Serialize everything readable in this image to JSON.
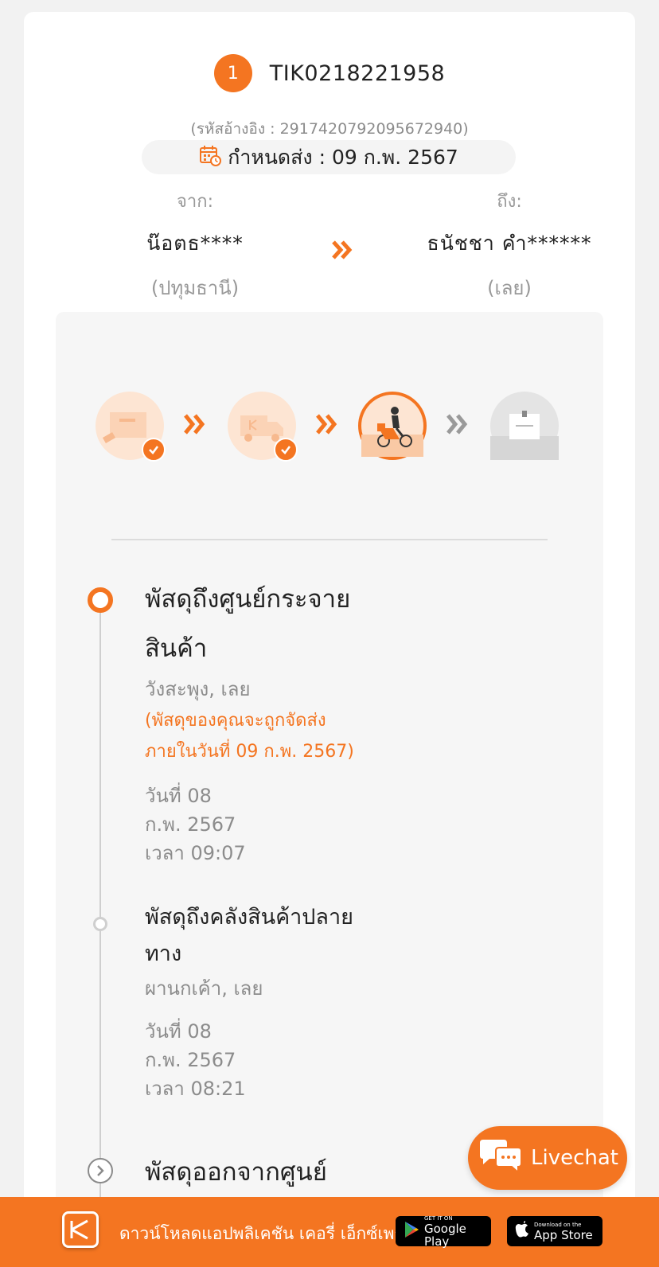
{
  "header": {
    "index": "1",
    "tracking_number": "TIK0218221958",
    "reference": "(รหัสอ้างอิง : 2917420792095672940)",
    "due_date": "กำหนดส่ง : 09 ก.พ. 2567"
  },
  "sender": {
    "label": "จาก:",
    "name": "น๊อตธ****",
    "province": "(ปทุมธานี)"
  },
  "receiver": {
    "label": "ถึง:",
    "name": "ธนัชชา คำ******",
    "province": "(เลย)"
  },
  "steps": [
    {
      "icon": "parcel-picked-icon",
      "done": true
    },
    {
      "icon": "truck-icon",
      "done": true
    },
    {
      "icon": "delivery-rider-icon",
      "current": true
    },
    {
      "icon": "delivered-box-icon",
      "done": false
    }
  ],
  "timeline": [
    {
      "title_line1": "พัสดุถึงศูนย์กระจาย",
      "title_line2": "สินค้า",
      "location": "วังสะพุง, เลย",
      "note_line1": "(พัสดุของคุณจะถูกจัดส่ง",
      "note_line2": "ภายในวันที่ 09 ก.พ. 2567)",
      "date_line1": "วันที่ 08",
      "date_line2": "ก.พ. 2567",
      "time": "เวลา 09:07"
    },
    {
      "title_line1": "พัสดุถึงคลังสินค้าปลาย",
      "title_line2": "ทาง",
      "location": "ผานกเค้า, เลย",
      "date_line1": "วันที่ 08",
      "date_line2": "ก.พ. 2567",
      "time": "เวลา 08:21"
    },
    {
      "title_line1": "พัสดุออกจากศูนย์"
    }
  ],
  "livechat": {
    "label": "Livechat"
  },
  "footer": {
    "text": "ดาวน์โหลดแอปพลิเคชัน เคอรี่ เอ็กซ์เพรส",
    "google_small": "GET IT ON",
    "google_big": "Google Play",
    "apple_small": "Download on the",
    "apple_big": "App Store"
  },
  "colors": {
    "accent": "#f47521",
    "muted": "#8c8c8c",
    "panel": "#f6f6f6"
  }
}
